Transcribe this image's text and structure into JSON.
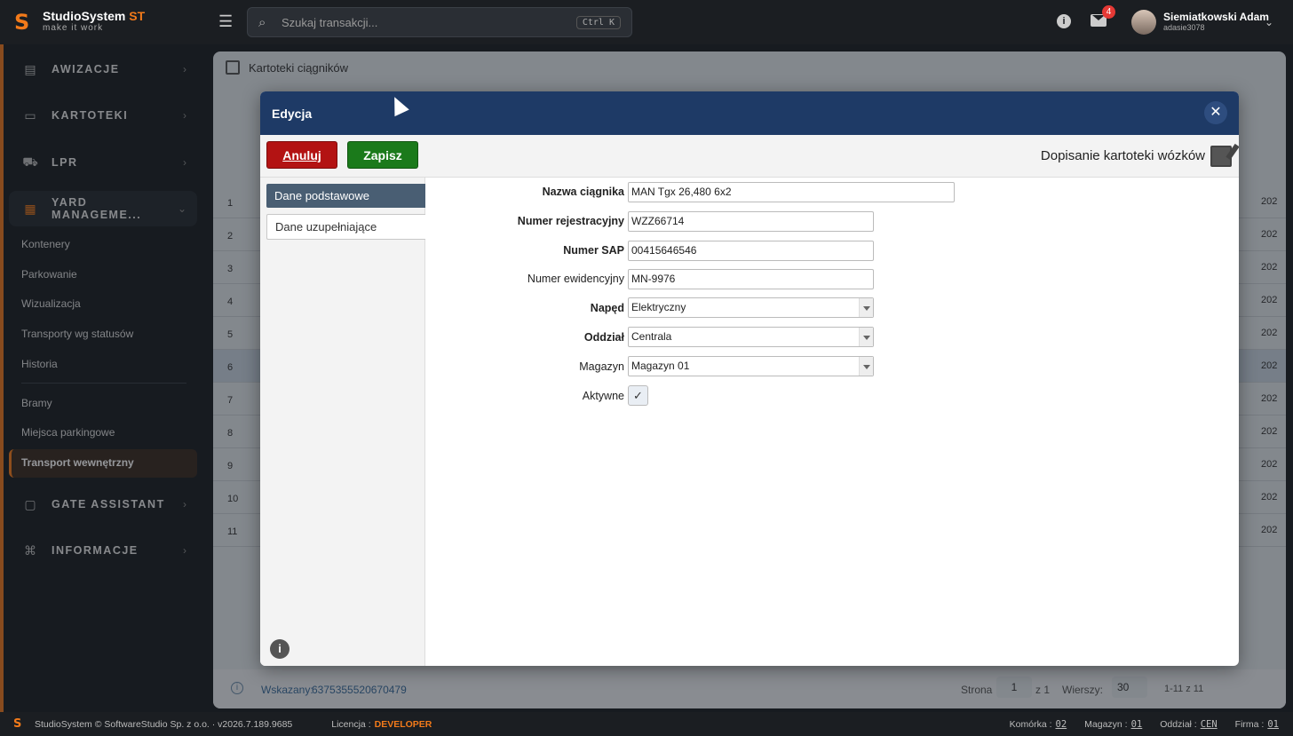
{
  "app": {
    "name_main": "StudioSystem ",
    "name_accent": "ST",
    "tagline": "make it work"
  },
  "search": {
    "placeholder": "Szukaj transakcji...",
    "shortcut": "Ctrl K"
  },
  "notifications": {
    "count": "4"
  },
  "user": {
    "name": "Siemiatkowski Adam",
    "login": "adasie3078"
  },
  "sidebar": {
    "sections": [
      {
        "label": "AWIZACJE",
        "icon": "clipboard-icon"
      },
      {
        "label": "KARTOTEKI",
        "icon": "folder-icon"
      },
      {
        "label": "LPR",
        "icon": "truck-icon"
      },
      {
        "label": "YARD MANAGEME...",
        "icon": "yard-icon"
      },
      {
        "label": "GATE ASSISTANT",
        "icon": "gate-icon"
      },
      {
        "label": "INFORMACJE",
        "icon": "sitemap-icon"
      }
    ],
    "yard_items": [
      "Kontenery",
      "Parkowanie",
      "Wizualizacja",
      "Transporty wg statusów",
      "Historia",
      "Bramy",
      "Miejsca parkingowe",
      "Transport wewnętrzny"
    ]
  },
  "content": {
    "breadcrumb": "Kartoteki ciągników",
    "rows": [
      "1",
      "2",
      "3",
      "4",
      "5",
      "6",
      "7",
      "8",
      "9",
      "10",
      "11"
    ],
    "right_values": [
      "202",
      "202",
      "202",
      "202",
      "202",
      "202",
      "202",
      "202",
      "202",
      "202",
      "202"
    ],
    "pager": {
      "selected_label": "Wskazany:",
      "selected_value": "6375355520670479",
      "page_label": "Strona",
      "page": "1",
      "of": "z 1",
      "rows_label": "Wierszy:",
      "rows": "30",
      "range": "1-11 z 11"
    }
  },
  "modal": {
    "title": "Edycja",
    "cancel": "Anuluj",
    "save": "Zapisz",
    "form_title": "Dopisanie kartoteki wózków",
    "tabs": [
      "Dane podstawowe",
      "Dane uzupełniające"
    ],
    "fields": {
      "name": {
        "label": "Nazwa ciągnika",
        "value": "MAN Tgx 26,480 6x2"
      },
      "reg": {
        "label": "Numer rejestracyjny",
        "value": "WZZ66714"
      },
      "sap": {
        "label": "Numer SAP",
        "value": "00415646546"
      },
      "evid": {
        "label": "Numer ewidencyjny",
        "value": "MN-9976"
      },
      "drive": {
        "label": "Napęd",
        "value": "Elektryczny"
      },
      "branch": {
        "label": "Oddział",
        "value": "Centrala"
      },
      "warehouse": {
        "label": "Magazyn",
        "value": "Magazyn 01"
      },
      "active": {
        "label": "Aktywne",
        "value": "✓"
      }
    }
  },
  "footer": {
    "copyright": "StudioSystem © SoftwareStudio Sp. z o.o. · v2026.7.189.9685",
    "license_label": "Licencja :",
    "license": "DEVELOPER",
    "cell_label": "Komórka :",
    "cell": "02",
    "warehouse_label": "Magazyn :",
    "warehouse": "01",
    "branch_label": "Oddział :",
    "branch": "CEN",
    "company_label": "Firma :",
    "company": "01"
  },
  "colors": {
    "accent": "#f27a1a",
    "modal_header": "#1e3a66",
    "cancel": "#b31313",
    "save": "#1b7a1b"
  }
}
